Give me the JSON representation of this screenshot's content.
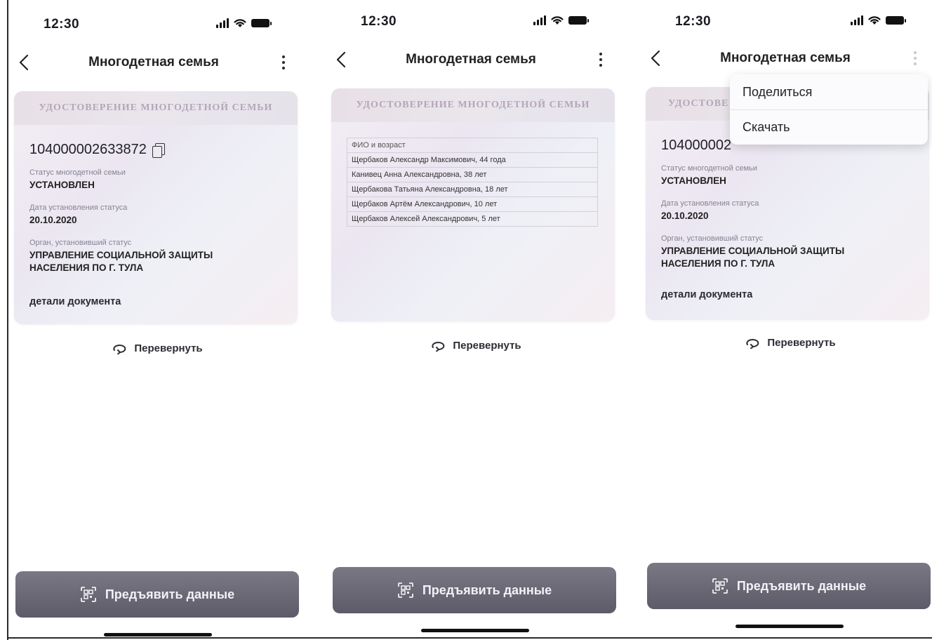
{
  "screens": [
    {
      "status_bar": {
        "time": "12:30"
      },
      "nav": {
        "title": "Многодетная семья"
      },
      "card": {
        "header": "УДОСТОВЕРЕНИЕ МНОГОДЕТНОЙ СЕМЬИ",
        "number": "104000002633872",
        "status_label": "Статус многодетной семьи",
        "status_value": "УСТАНОВЛЕН",
        "date_label": "Дата установления статуса",
        "date_value": "20.10.2020",
        "authority_label": "Орган, установивший статус",
        "authority_value_line1": "УПРАВЛЕНИЕ СОЦИАЛЬНОЙ ЗАЩИТЫ",
        "authority_value_line2": "НАСЕЛЕНИЯ ПО Г. ТУЛА",
        "details_link": "детали документа"
      },
      "flip_label": "Перевернуть",
      "present_button": "Предъявить данные"
    },
    {
      "status_bar": {
        "time": "12:30"
      },
      "nav": {
        "title": "Многодетная семья"
      },
      "card": {
        "header": "УДОСТОВЕРЕНИЕ МНОГОДЕТНОЙ СЕМЬИ",
        "table_header": "ФИО и возраст",
        "members": [
          "Щербаков Александр Максимович, 44 года",
          "Канивец Анна Александровна, 38 лет",
          "Щербакова Татьяна Александровна, 18 лет",
          "Щербаков Артём Александрович, 10 лет",
          "Щербаков Алексей Александрович, 5 лет"
        ]
      },
      "flip_label": "Перевернуть",
      "present_button": "Предъявить данные"
    },
    {
      "status_bar": {
        "time": "12:30"
      },
      "nav": {
        "title": "Многодетная семья"
      },
      "card": {
        "header_partial": "УДОСТОВЕ",
        "number_partial": "104000002",
        "status_label": "Статус многодетной семьи",
        "status_value": "УСТАНОВЛЕН",
        "date_label": "Дата установления статуса",
        "date_value": "20.10.2020",
        "authority_label": "Орган, установивший статус",
        "authority_value_line1": "УПРАВЛЕНИЕ СОЦИАЛЬНОЙ ЗАЩИТЫ",
        "authority_value_line2": "НАСЕЛЕНИЯ ПО Г. ТУЛА",
        "details_link": "детали документа"
      },
      "menu": {
        "share": "Поделиться",
        "download": "Скачать"
      },
      "flip_label": "Перевернуть",
      "present_button": "Предъявить данные"
    }
  ],
  "icons": [
    "chevron-left-icon",
    "more-vertical-icon",
    "copy-icon",
    "flip-icon",
    "qr-icon",
    "signal-icon",
    "wifi-icon",
    "battery-icon"
  ],
  "colors": {
    "button_bg": "#67656f",
    "card_header_text": "#b4a6ba",
    "card_bg": "#eee9f2"
  }
}
